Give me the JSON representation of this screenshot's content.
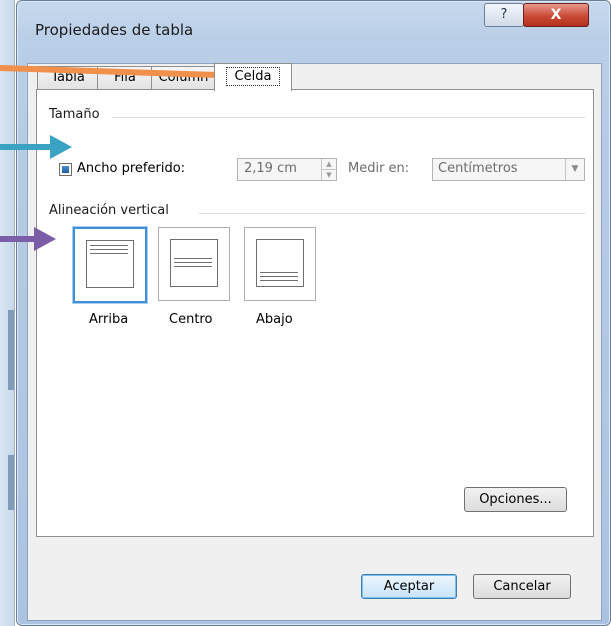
{
  "dialog": {
    "title": "Propiedades de tabla",
    "help_glyph": "?",
    "close_glyph": "X"
  },
  "tabs": [
    {
      "label": "Tabla",
      "active": false
    },
    {
      "label": "Fila",
      "active": false
    },
    {
      "label": "Column",
      "active": false
    },
    {
      "label": "Celda",
      "active": true
    }
  ],
  "size_group": {
    "label": "Tamaño",
    "checkbox_label": "Ancho preferido:",
    "checkbox_checked": true,
    "width_value": "2,19 cm",
    "measure_label": "Medir en:",
    "measure_value": "Centímetros"
  },
  "vertical_group": {
    "label": "Alineación vertical",
    "options": [
      {
        "label": "Arriba",
        "selected": true
      },
      {
        "label": "Centro",
        "selected": false
      },
      {
        "label": "Abajo",
        "selected": false
      }
    ]
  },
  "buttons": {
    "options": "Opciones...",
    "accept": "Aceptar",
    "cancel": "Cancelar"
  },
  "annotation_colors": {
    "tab_arrow": "#f0904a",
    "checkbox_arrow": "#3aa3c3",
    "align_arrow": "#7b5ea7"
  }
}
